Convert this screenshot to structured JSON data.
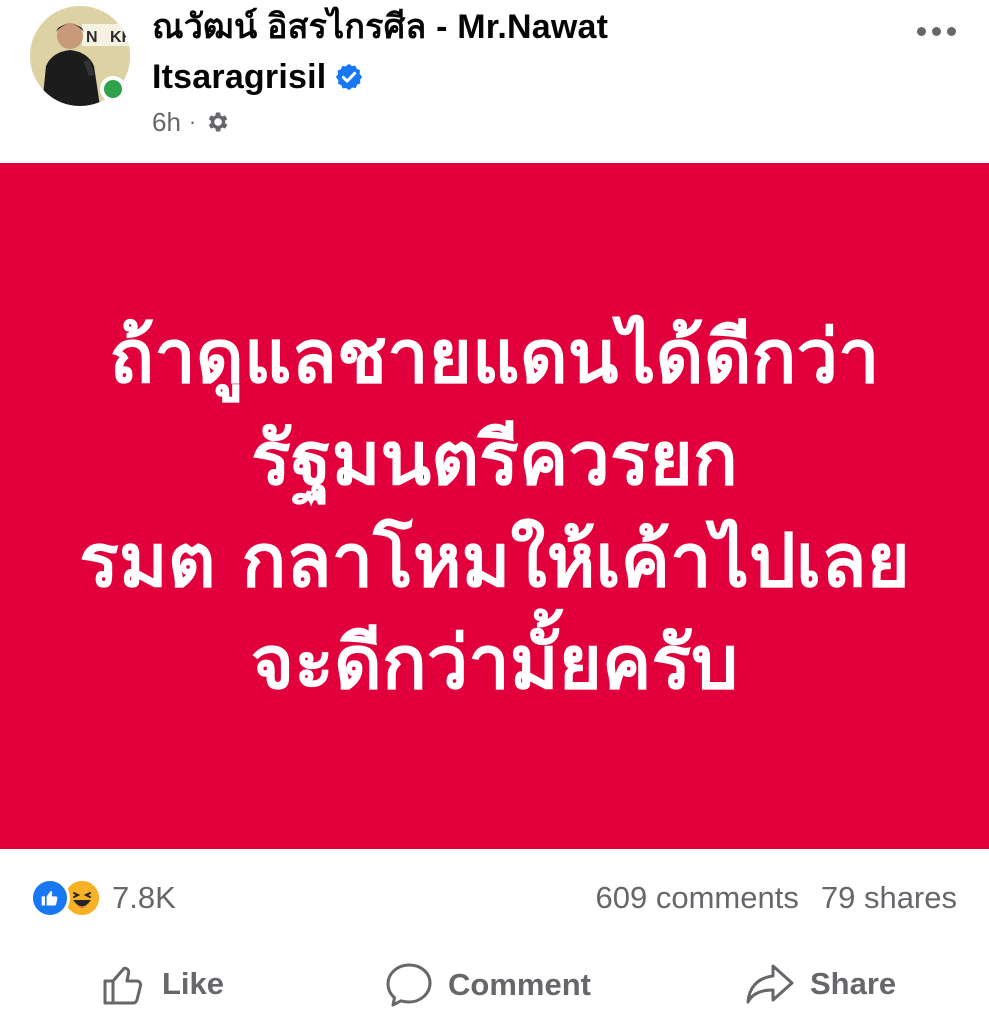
{
  "post": {
    "author_line1": "ณวัฒน์ อิสรไกรศีล - Mr.Nawat",
    "author_line2": "Itsaragrisil",
    "time": "6h",
    "separator": "·",
    "audience_icon": "gear-icon",
    "more_icon": "more-dots-icon",
    "verified_icon": "verified-badge-icon"
  },
  "banner": {
    "background": "#e1003b",
    "lines": [
      "ถ้าดูแลชายแดนได้ดีกว่า",
      "รัฐมนตรีควรยก",
      "รมต กลาโหมให้เค้าไปเลย",
      "จะดีกว่ามั้ยครับ"
    ]
  },
  "stats": {
    "reaction_count": "7.8K",
    "reaction_icons": [
      "like-reaction-icon",
      "haha-reaction-icon"
    ],
    "comments": "609 comments",
    "shares": "79 shares"
  },
  "actions": {
    "like": "Like",
    "comment": "Comment",
    "share": "Share"
  },
  "colors": {
    "facebook_blue": "#1877f2",
    "online_green": "#31a24c",
    "secondary_text": "#65676b"
  }
}
